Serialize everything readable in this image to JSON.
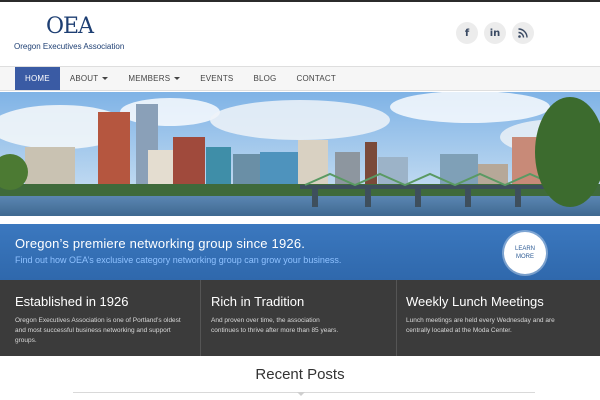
{
  "header": {
    "logo_mark": "OEA",
    "logo_text": "Oregon Executives Association",
    "social": [
      {
        "icon": "facebook-icon",
        "glyph": "f"
      },
      {
        "icon": "linkedin-icon",
        "glyph": "in"
      },
      {
        "icon": "rss-icon",
        "glyph": "⌁"
      }
    ]
  },
  "nav": {
    "items": [
      {
        "label": "HOME",
        "active": true,
        "caret": false
      },
      {
        "label": "ABOUT",
        "active": false,
        "caret": true
      },
      {
        "label": "MEMBERS",
        "active": false,
        "caret": true
      },
      {
        "label": "EVENTS",
        "active": false,
        "caret": false
      },
      {
        "label": "BLOG",
        "active": false,
        "caret": false
      },
      {
        "label": "CONTACT",
        "active": false,
        "caret": false
      }
    ]
  },
  "hero_band": {
    "title": "Oregon’s premiere networking group since 1926.",
    "subtitle": "Find out how OEA’s exclusive category networking group can grow your business.",
    "cta_line1": "LEARN",
    "cta_line2": "MORE"
  },
  "features": [
    {
      "title": "Established in 1926",
      "text": "Oregon Executives Association is one of Portland’s oldest and most successful business networking and support groups."
    },
    {
      "title": "Rich in Tradition",
      "text": "And proven over time, the association continues to thrive after more than 85 years."
    },
    {
      "title": "Weekly Lunch Meetings",
      "text": "Lunch meetings are held every Wednesday and are centrally located at the Moda Center."
    }
  ],
  "recent_posts": {
    "title": "Recent Posts"
  },
  "colors": {
    "accent": "#3a5ba4",
    "band": "#3474b8",
    "dark": "#3b3b3b"
  }
}
